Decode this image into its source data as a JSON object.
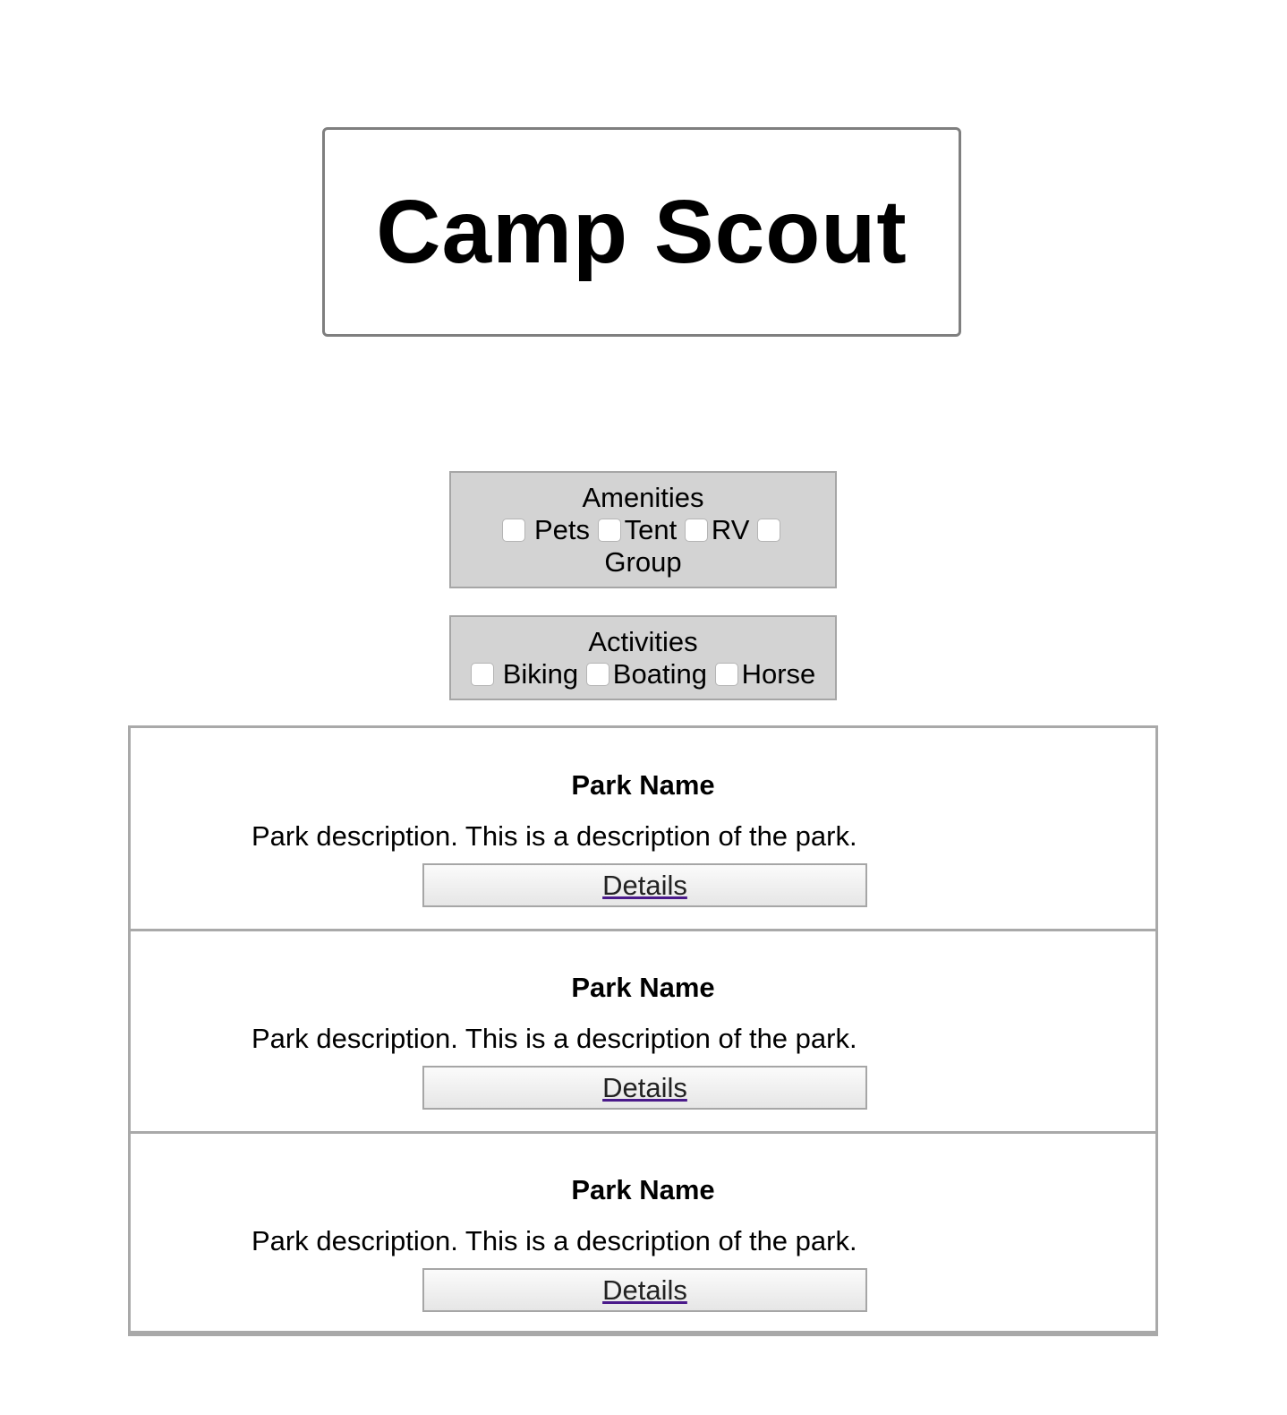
{
  "header": {
    "title": "Camp Scout"
  },
  "filters": {
    "amenities": {
      "title": "Amenities",
      "options": [
        "Pets",
        "Tent",
        "RV",
        "Group"
      ]
    },
    "activities": {
      "title": "Activities",
      "options": [
        "Biking",
        "Boating",
        "Horse"
      ]
    }
  },
  "parks": [
    {
      "name": "Park Name",
      "description": "Park description. This is a description of the park.",
      "details_label": "Details"
    },
    {
      "name": "Park Name",
      "description": "Park description. This is a description of the park.",
      "details_label": "Details"
    },
    {
      "name": "Park Name",
      "description": "Park description. This is a description of the park.",
      "details_label": "Details"
    }
  ],
  "colors": {
    "filter_background": "#d3d3d3",
    "border": "#a9a9a9",
    "link": "#222222"
  }
}
